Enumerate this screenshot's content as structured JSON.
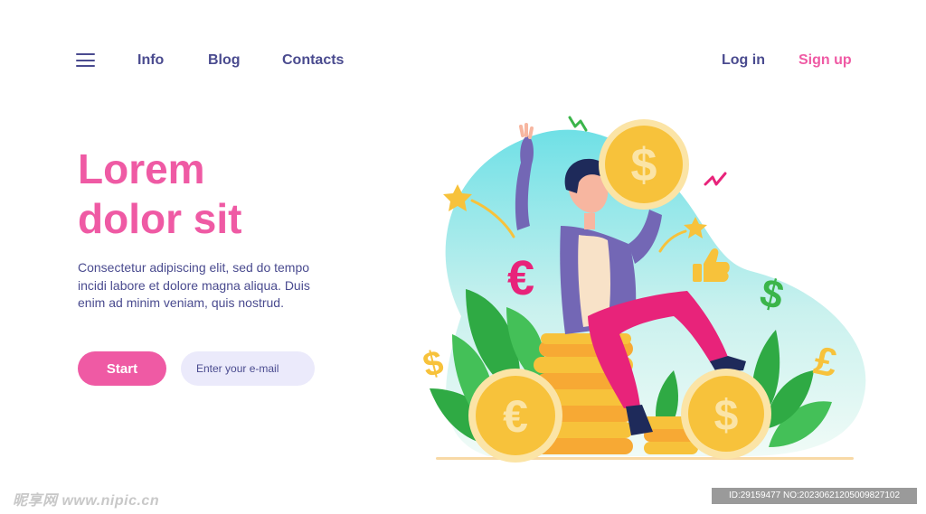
{
  "nav": {
    "links": [
      "Info",
      "Blog",
      "Contacts"
    ],
    "login": "Log in",
    "signup": "Sign up"
  },
  "hero": {
    "title_line1": "Lorem",
    "title_line2": "dolor sit",
    "body": "Consectetur adipiscing elit, sed do tempo incidi labore et dolore magna aliqua. Duis enim ad minim veniam, quis nostrud.",
    "start_label": "Start",
    "email_placeholder": "Enter your e-mail"
  },
  "illustration": {
    "symbols": [
      "$",
      "€",
      "£"
    ]
  },
  "watermark": {
    "left": "昵享网 www.nipic.cn",
    "right": "ID:29159477 NO:20230621205009827102"
  },
  "colors": {
    "brand_pink": "#ef5aa4",
    "navy": "#4a4b8f",
    "input_bg": "#ebeafb",
    "coin_gold": "#f7c23b"
  }
}
